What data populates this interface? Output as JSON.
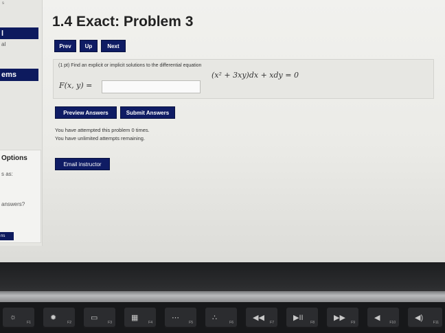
{
  "page": {
    "title": "1.4 Exact: Problem 3",
    "nav": {
      "prev": "Prev",
      "up": "Up",
      "next": "Next"
    }
  },
  "sidebar": {
    "corner": "s",
    "block1": "l",
    "text1": "al",
    "block2": "ems",
    "options": "Options",
    "text2": "s as:",
    "text3": "answers?",
    "badge": "ns"
  },
  "problem": {
    "prompt": "(1 pt) Find an explicit or implicit solutions to the differential equation",
    "equation": "(x² + 3xy)dx + xdy = 0",
    "answer_label": "F(x, y) =",
    "answer_value": "",
    "answer_placeholder": ""
  },
  "actions": {
    "preview": "Preview Answers",
    "submit": "Submit Answers"
  },
  "messages": {
    "attempted": "You have attempted this problem 0 times.",
    "remaining": "You have unlimited attempts remaining."
  },
  "email": "Email instructor",
  "keyboard": {
    "keys": [
      {
        "icon": "brightness-down-icon",
        "glyph": "☼",
        "fn": "F1"
      },
      {
        "icon": "brightness-up-icon",
        "glyph": "✹",
        "fn": "F2"
      },
      {
        "icon": "mission-control-icon",
        "glyph": "▭",
        "fn": "F3"
      },
      {
        "icon": "launchpad-icon",
        "glyph": "▦",
        "fn": "F4"
      },
      {
        "icon": "keyboard-light-down-icon",
        "glyph": "⋯",
        "fn": "F5"
      },
      {
        "icon": "keyboard-light-up-icon",
        "glyph": "∴",
        "fn": "F6"
      },
      {
        "icon": "rewind-icon",
        "glyph": "◀◀",
        "fn": "F7"
      },
      {
        "icon": "play-pause-icon",
        "glyph": "▶II",
        "fn": "F8"
      },
      {
        "icon": "fast-forward-icon",
        "glyph": "▶▶",
        "fn": "F9"
      },
      {
        "icon": "mute-icon",
        "glyph": "◀",
        "fn": "F10"
      },
      {
        "icon": "volume-icon",
        "glyph": "◀)",
        "fn": "F11"
      }
    ]
  },
  "colors": {
    "button": "#0f1c64",
    "panel": "#e7e7e3"
  }
}
